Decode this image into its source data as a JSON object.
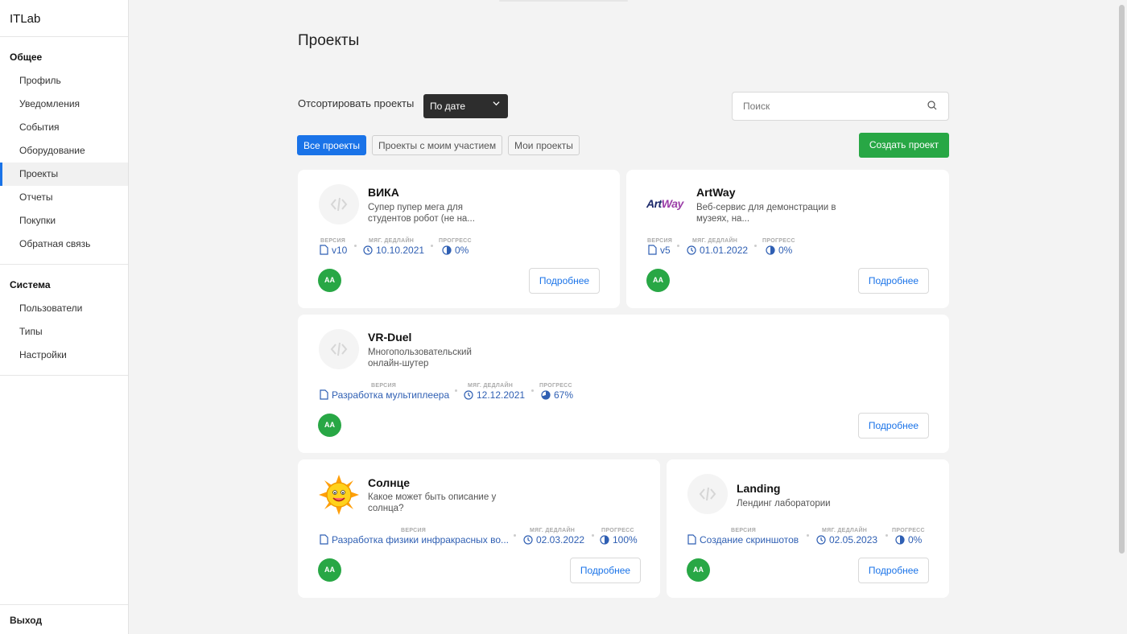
{
  "sidebar": {
    "brand": "ITLab",
    "groups": [
      {
        "title": "Общее",
        "items": [
          "Профиль",
          "Уведомления",
          "События",
          "Оборудование",
          "Проекты",
          "Отчеты",
          "Покупки",
          "Обратная связь"
        ]
      },
      {
        "title": "Система",
        "items": [
          "Пользователи",
          "Типы",
          "Настройки"
        ]
      }
    ],
    "active_item": "Проекты",
    "logout": "Выход"
  },
  "page": {
    "title": "Проекты",
    "sort_label": "Отсортировать проекты",
    "sort_value": "По дате",
    "search_placeholder": "Поиск",
    "filters": [
      "Все проекты",
      "Проекты с моим участием",
      "Мои проекты"
    ],
    "active_filter": "Все проекты",
    "create_button": "Создать проект"
  },
  "meta_labels": {
    "version": "ВЕРСИЯ",
    "deadline": "МЯГ. ДЕДЛАЙН",
    "progress": "ПРОГРЕСС"
  },
  "projects": [
    {
      "title": "ВИКА",
      "description": "Супер пупер мега для студентов робот (не на...",
      "logo": "code-placeholder-icon",
      "version": "v10",
      "deadline": "10.10.2021",
      "progress": "0%",
      "avatar": "AA",
      "button": "Подробнее"
    },
    {
      "title": "ArtWay",
      "description": "Веб-сервис для демонстрации в музеях, на...",
      "logo": "artway-logo",
      "logo_text_1": "Art",
      "logo_text_2": "Way",
      "version": "v5",
      "deadline": "01.01.2022",
      "progress": "0%",
      "avatar": "AA",
      "button": "Подробнее"
    },
    {
      "title": "VR-Duel",
      "description": "Многопользовательский онлайн-шутер",
      "logo": "code-placeholder-icon",
      "version": "Разработка мультиплеера",
      "deadline": "12.12.2021",
      "progress": "67%",
      "avatar": "AA",
      "button": "Подробнее"
    },
    {
      "title": "Солнце",
      "description": "Какое может быть описание у солнца?",
      "logo": "sun-icon",
      "version": "Разработка физики инфракрасных во...",
      "deadline": "02.03.2022",
      "progress": "100%",
      "avatar": "AA",
      "button": "Подробнее"
    },
    {
      "title": "Landing",
      "description": "Лендинг лаборатории",
      "logo": "code-placeholder-icon",
      "version": "Создание скриншотов",
      "deadline": "02.05.2023",
      "progress": "0%",
      "avatar": "AA",
      "button": "Подробнее"
    }
  ],
  "colors": {
    "primary": "#1a73e8",
    "success": "#28a745",
    "link": "#2f5fb3",
    "dark_select": "#2d2d2d"
  }
}
